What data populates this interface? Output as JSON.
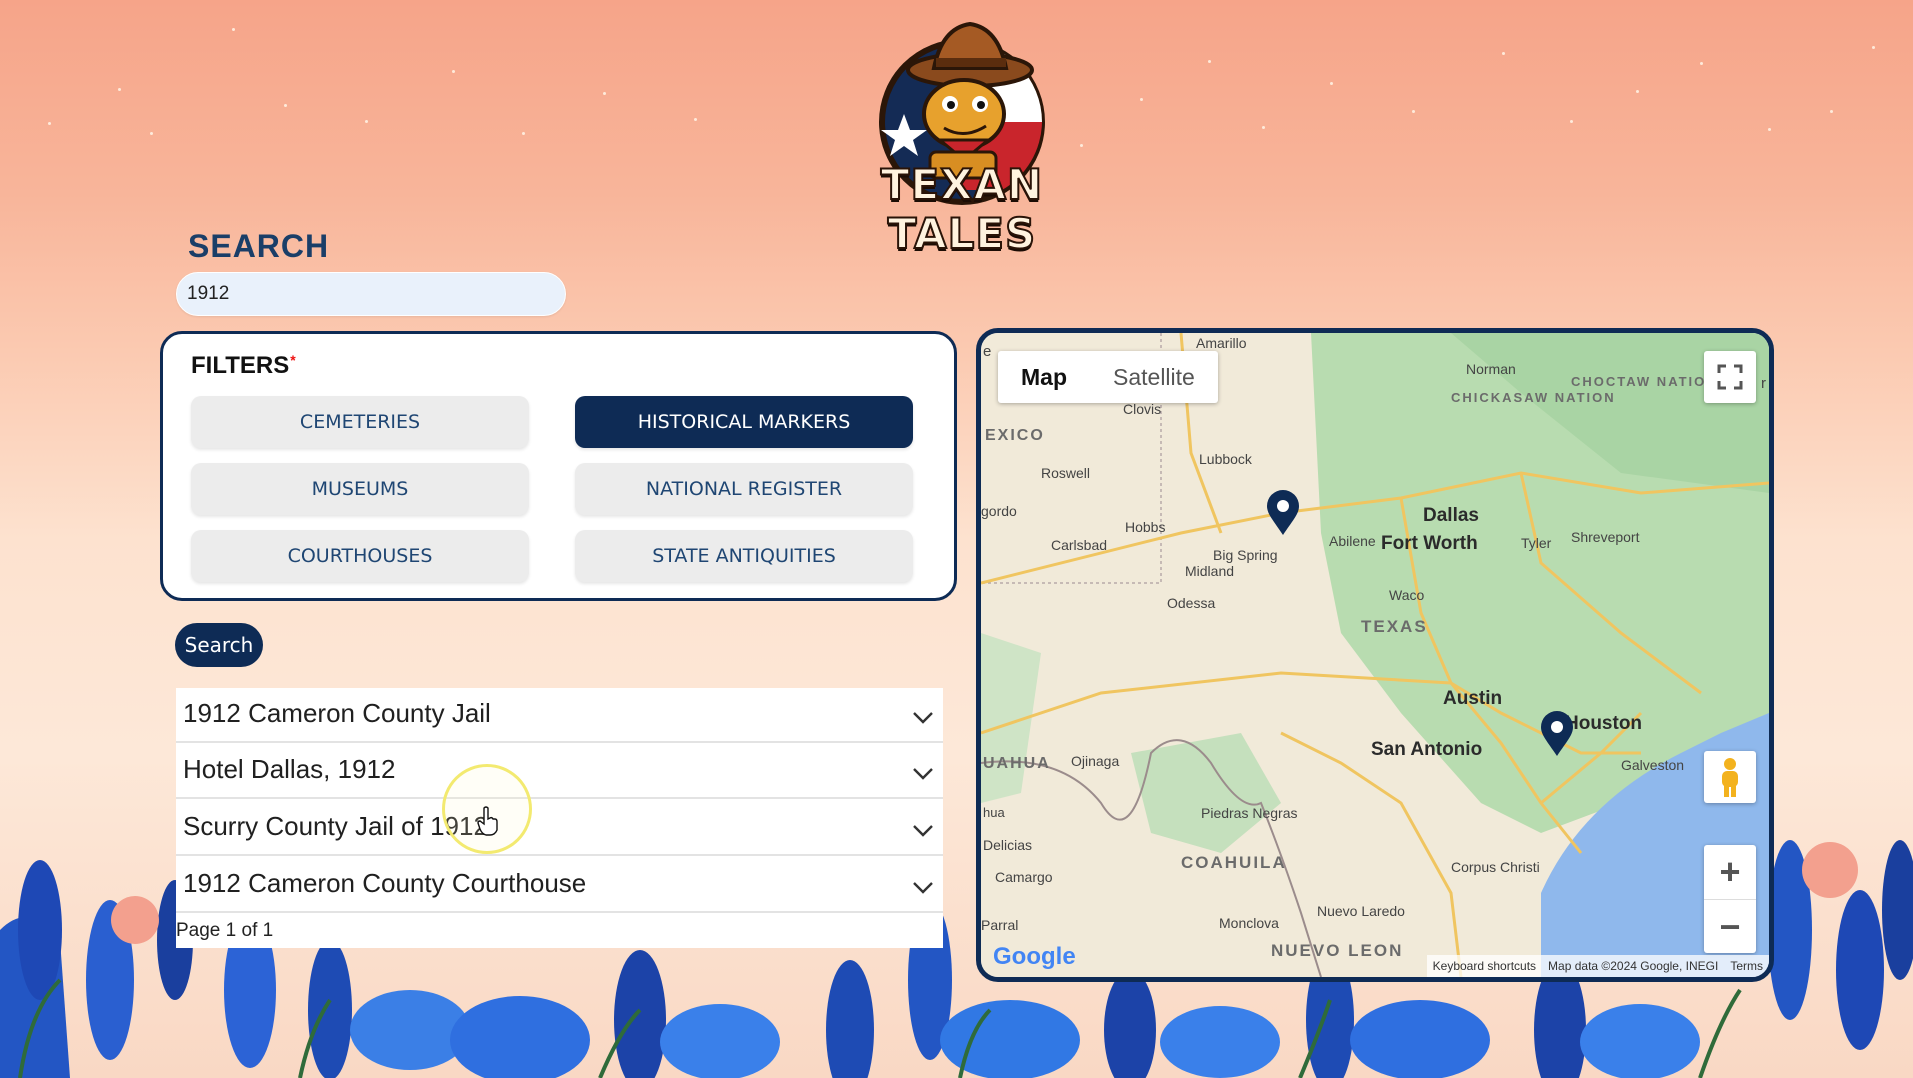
{
  "logo": {
    "name": "TEXAN TALES",
    "icon": "cowboy-lizard-logo"
  },
  "search": {
    "title": "SEARCH",
    "value": "1912"
  },
  "filters": {
    "title": "FILTERS",
    "required_mark": "*",
    "buttons": [
      {
        "label": "CEMETERIES",
        "active": false
      },
      {
        "label": "HISTORICAL MARKERS",
        "active": true
      },
      {
        "label": "MUSEUMS",
        "active": false
      },
      {
        "label": "NATIONAL REGISTER",
        "active": false
      },
      {
        "label": "COURTHOUSES",
        "active": false
      },
      {
        "label": "STATE ANTIQUITIES",
        "active": false
      }
    ]
  },
  "search_button": "Search",
  "results": [
    {
      "title": "1912 Cameron County Jail"
    },
    {
      "title": "Hotel Dallas, 1912"
    },
    {
      "title": "Scurry County Jail of 1912"
    },
    {
      "title": "1912 Cameron County Courthouse"
    }
  ],
  "pager": "Page 1 of 1",
  "map": {
    "tabs": [
      "Map",
      "Satellite"
    ],
    "active_tab": "Map",
    "labels": {
      "amarillo": "Amarillo",
      "norman": "Norman",
      "chickasaw": "CHICKASAW NATION",
      "choctaw": "CHOCTAW NATION",
      "clovis": "Clovis",
      "mexico": "EXICO",
      "lubbock": "Lubbock",
      "roswell": "Roswell",
      "gordo": "gordo",
      "hobbs": "Hobbs",
      "carlsbad": "Carlsbad",
      "bigspring": "Big Spring",
      "midland": "Midland",
      "abilene": "Abilene",
      "dallas": "Dallas",
      "fortworth": "Fort Worth",
      "tyler": "Tyler",
      "shreveport": "Shreveport",
      "odessa": "Odessa",
      "waco": "Waco",
      "texas": "TEXAS",
      "austin": "Austin",
      "houston": "Houston",
      "sanantonio": "San Antonio",
      "galveston": "Galveston",
      "chihuahua": "UAHUA",
      "ojinaga": "Ojinaga",
      "hua": "hua",
      "delicias": "Delicias",
      "piedras": "Piedras Negras",
      "camargo": "Camargo",
      "coahuila": "COAHUILA",
      "corpus": "Corpus Christi",
      "parral": "Parral",
      "nuevolaredo": "Nuevo Laredo",
      "monclova": "Monclova",
      "nuevoleon": "NUEVO LEON",
      "edge_e": "e",
      "edge_r": "r"
    },
    "attribution": [
      "Keyboard shortcuts",
      "Map data ©2024 Google, INEGI",
      "Terms"
    ],
    "brand": "Google",
    "controls": {
      "fullscreen": "fullscreen-icon",
      "pegman": "pegman-icon",
      "zoom_in": "+",
      "zoom_out": "−"
    },
    "pins": [
      "pin-west",
      "pin-houston"
    ]
  },
  "colors": {
    "navy": "#0e2b55",
    "accent_text": "#1a3e68",
    "water": "#8fb8ec",
    "land": "#efe6d6",
    "green": "#a9d4a4"
  }
}
